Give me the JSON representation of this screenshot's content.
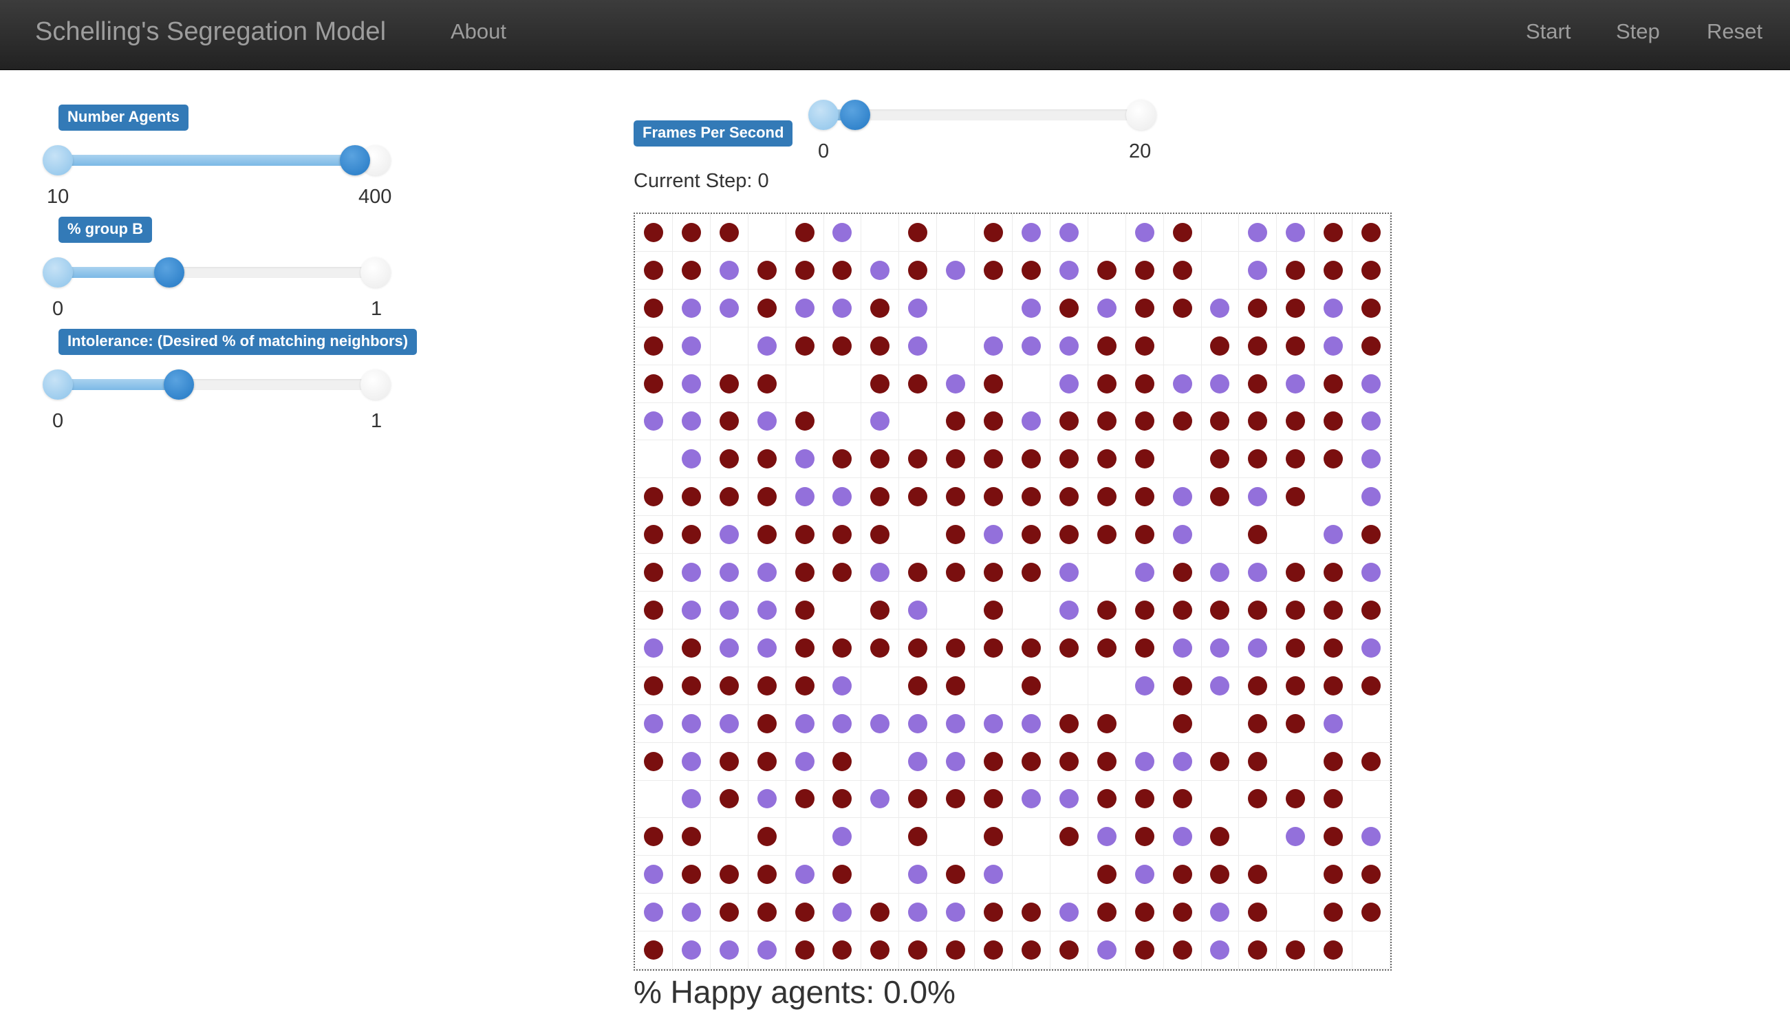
{
  "app": {
    "title": "Schelling's Segregation Model",
    "nav": {
      "about": "About",
      "start": "Start",
      "step": "Step",
      "reset": "Reset"
    }
  },
  "controls": {
    "number_agents": {
      "label": "Number Agents",
      "min": "10",
      "max": "400",
      "value": 375
    },
    "group_b": {
      "label": "% group B",
      "min": "0",
      "max": "1",
      "value": 0.35
    },
    "intolerance": {
      "label": "Intolerance: (Desired % of matching neighbors)",
      "min": "0",
      "max": "1",
      "value": 0.38
    },
    "fps": {
      "label": "Frames Per Second",
      "min": "0",
      "max": "20",
      "value": 2
    }
  },
  "status": {
    "current_step": "Current Step: 0",
    "happy": "% Happy agents: 0.0%"
  },
  "colors": {
    "group_a": "#7a0f0f",
    "group_b": "#9370db",
    "accent": "#337ab7",
    "navbar": "#222222"
  },
  "grid": {
    "legend": "R = group A agent (dark red), P = group B agent (purple), . = empty cell",
    "rows": [
      "RRR.RP.R.RPP.PR.PPRR",
      "RRPRRRPRPRRPRRR.PRRR",
      "RPPRPPRP..PRPRRPRRPR",
      "RP.PRRRP.PPPRR.RRRPR",
      "RPRR..RRPR.PRRPPRPRP",
      "PPRPR.P.RRPRRRRRRRRP",
      ".PRRPRRRRRRRRR.RRRRP",
      "RRRRPPRRRRRRRRPRPR.P",
      "RRPRRRR.RPRRRRP.R.PR",
      "RPPPRRPRRRRP.PRPPRRP",
      "RPPPR.RP.R.PRRRRRRRR",
      "PRPPRRRRRRRRRRPPPRRP",
      "RRRRRP.RR.R..PRPRRRR",
      "PPPRPPPPPPPRR.R.RRP.",
      "RPRRPR.PPRRRRPPRR.RR",
      ".PRPRRPRRRPPRRR.RRR.",
      "RR.R.P.R.R.RPRPR.PRP",
      "PRRRPR.PRP..RPRRR.RR",
      "PPRRRPRPPRRPRRRPR.RR",
      "RPPPRRRRRRRRPRRPRRR."
    ]
  }
}
